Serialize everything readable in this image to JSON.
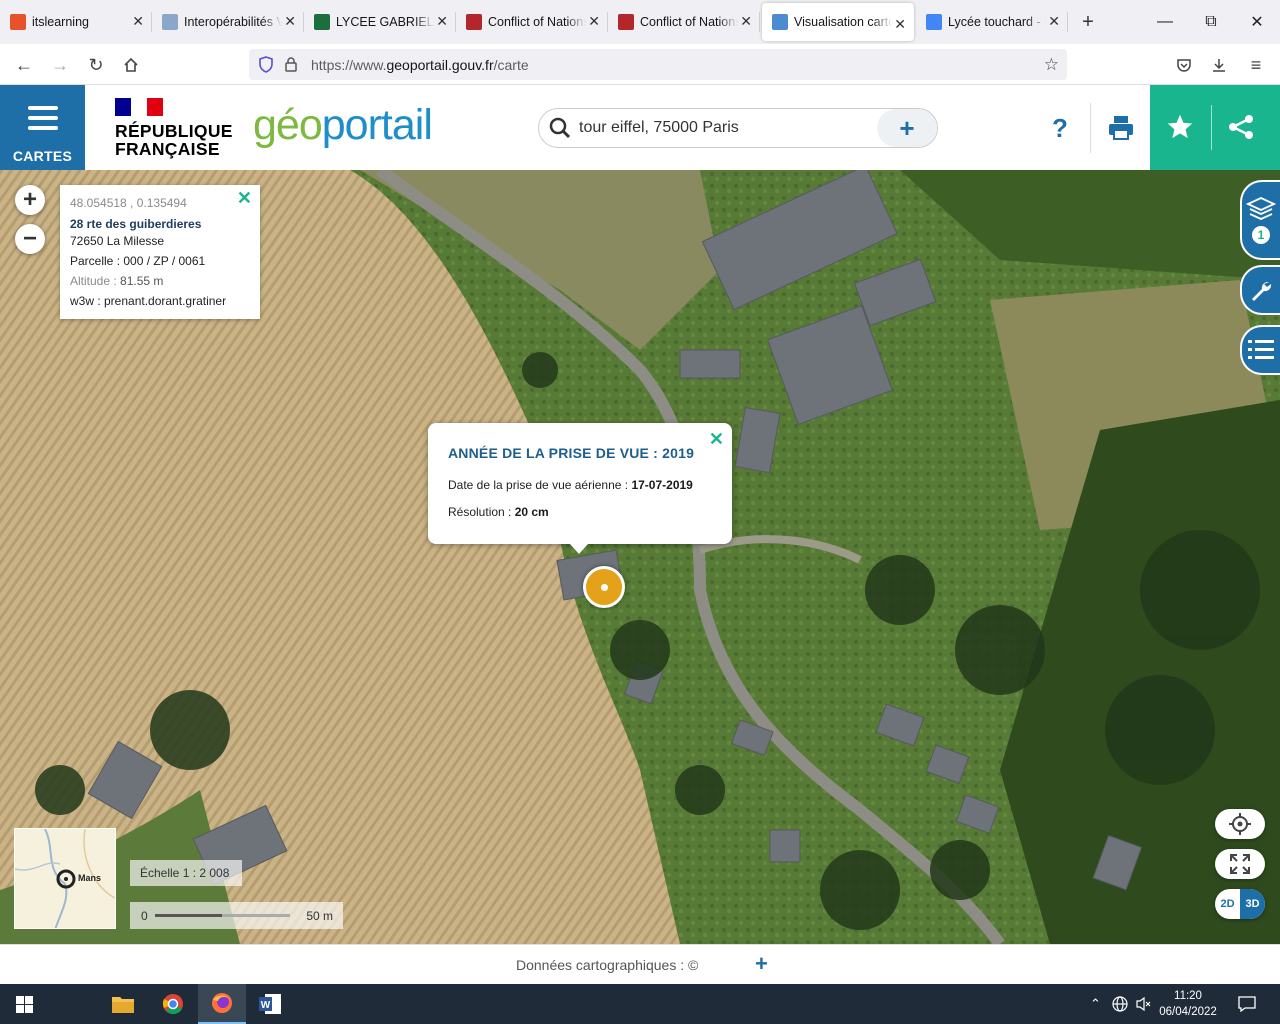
{
  "browser": {
    "tabs": [
      {
        "title": "itslearning",
        "favicon": "itslearning-icon",
        "color": "#e8522a",
        "active": false
      },
      {
        "title": "Interopérabilités V",
        "favicon": "document-icon",
        "color": "#8aa6c8",
        "active": false
      },
      {
        "title": "LYCEE GABRIEL TOUCHARD",
        "favicon": "school-icon",
        "color": "#1d6e3f",
        "active": false
      },
      {
        "title": "Conflict of Nations",
        "favicon": "conflict-icon",
        "color": "#b3262a",
        "active": false
      },
      {
        "title": "Conflict of Nations",
        "favicon": "conflict-icon",
        "color": "#b3262a",
        "active": false
      },
      {
        "title": "Visualisation carto",
        "favicon": "geoportail-icon",
        "color": "#4a8ccf",
        "active": true
      },
      {
        "title": "Lycée touchard - R",
        "favicon": "google-icon",
        "color": "#4285f4",
        "active": false
      }
    ],
    "url_prefix": "https://www.",
    "url_host": "geoportail.gouv.fr",
    "url_path": "/carte"
  },
  "header": {
    "menu_label": "CARTES",
    "rf_line1": "RÉPUBLIQUE",
    "rf_line2": "FRANÇAISE",
    "logo_part1": "géo",
    "logo_part2": "portail",
    "search_value": "tour eiffel, 75000 Paris",
    "help_label": "?"
  },
  "info_panel": {
    "coords": "48.054518 , 0.135494",
    "street": "28 rte des guiberdieres",
    "city": "72650 La Milesse",
    "parcel": "Parcelle : 000 / ZP / 0061",
    "altitude_label": "Altitude : ",
    "altitude_value": "81.55 m",
    "w3w": "w3w : prenant.dorant.gratiner"
  },
  "popup": {
    "title": "ANNÉE DE LA PRISE DE VUE : 2019",
    "date_label": "Date de la prise de vue aérienne : ",
    "date_value": "17-07-2019",
    "res_label": "Résolution : ",
    "res_value": "20 cm"
  },
  "map_controls": {
    "layers_count": "1",
    "mode_2d": "2D",
    "mode_3d": "3D"
  },
  "minimap": {
    "label": "Mans"
  },
  "scale": {
    "text": "Échelle 1 : 2 008",
    "bar_start": "0",
    "bar_end": "50 m"
  },
  "footer": {
    "attribution": "Données cartographiques : ©",
    "plus": "+"
  },
  "taskbar": {
    "time": "11:20",
    "date": "06/04/2022"
  },
  "colors": {
    "geoportail_blue": "#1e6fa8",
    "accent_green": "#19b58e",
    "marker_orange": "#e3a21a"
  }
}
